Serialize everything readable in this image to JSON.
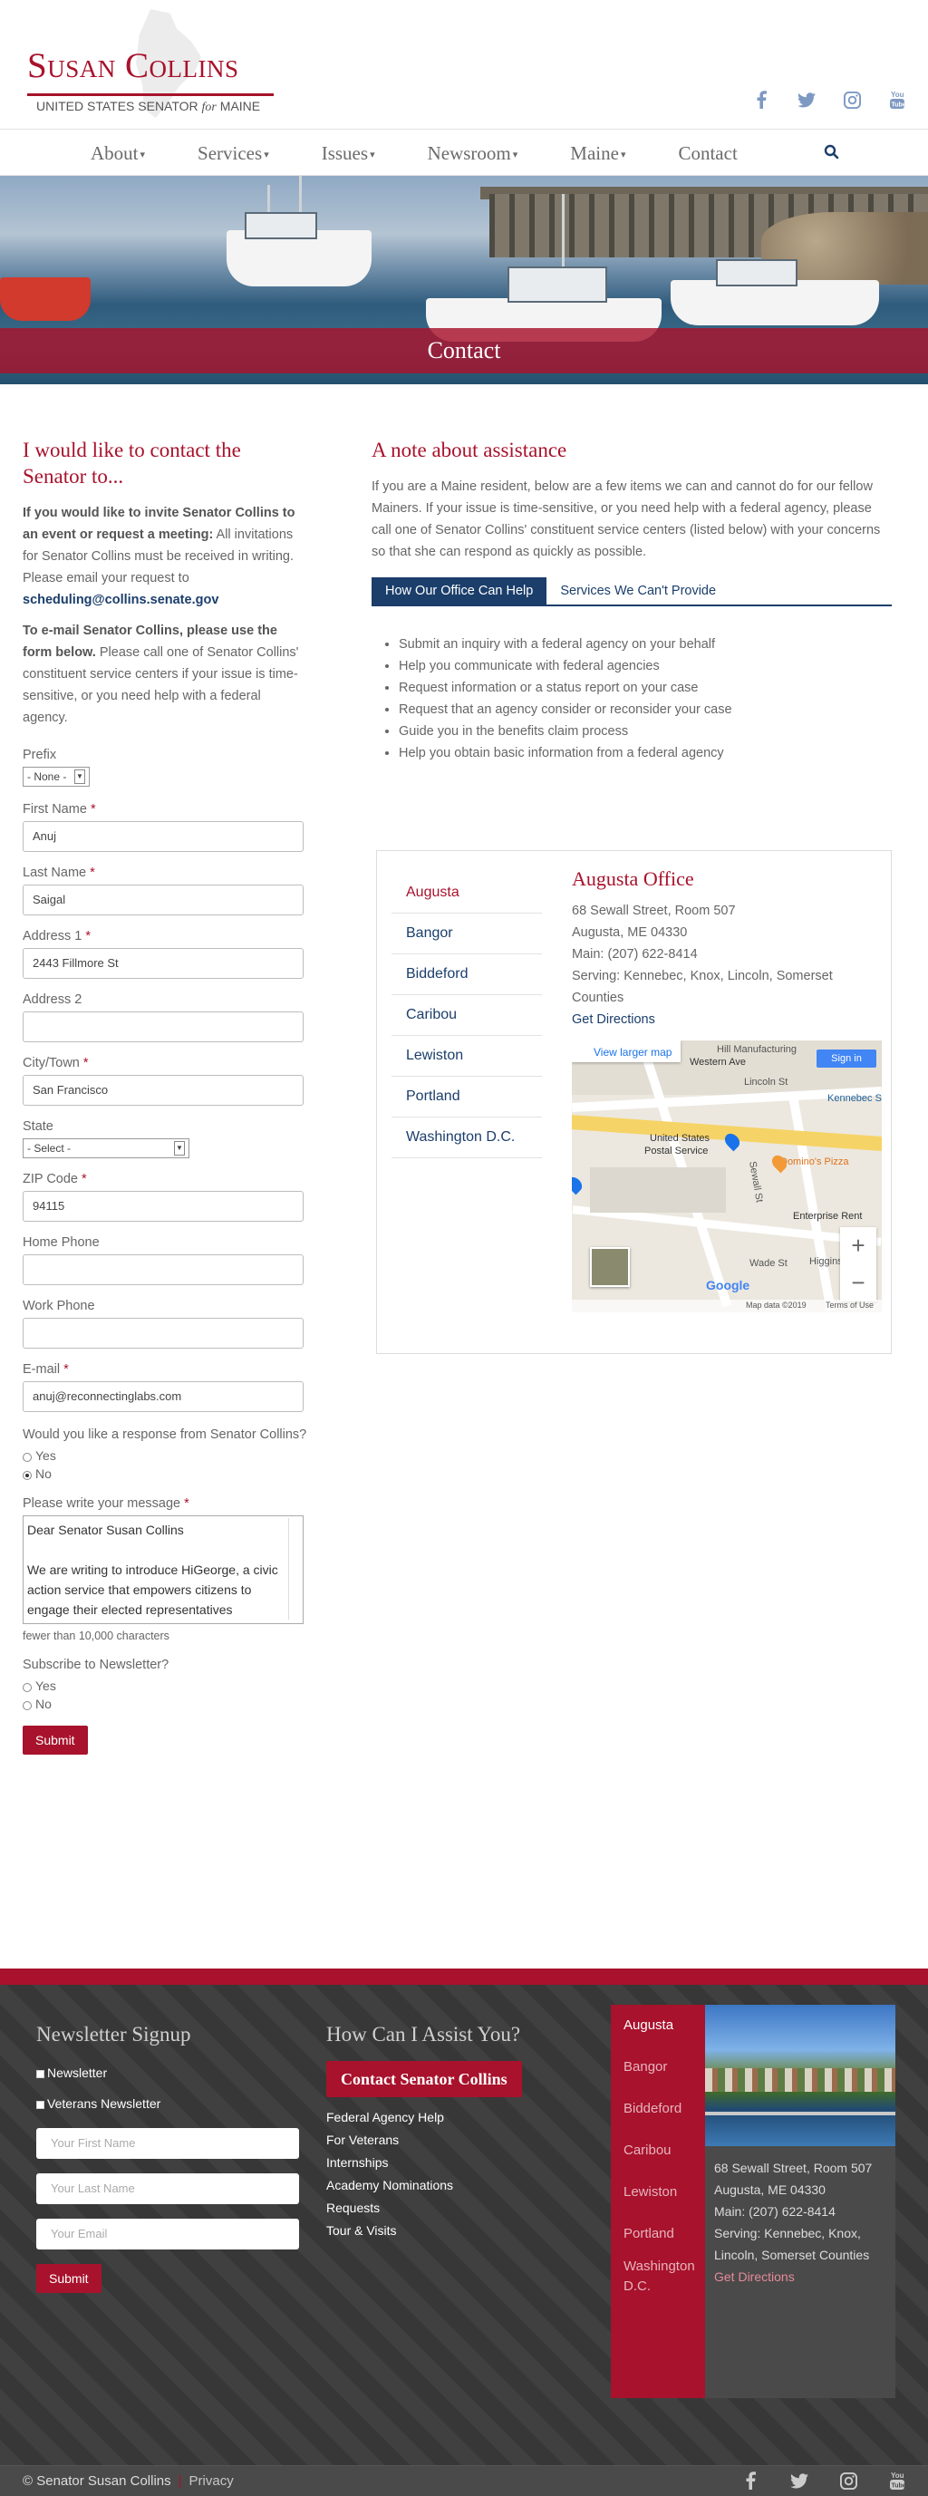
{
  "brand": {
    "name": "Susan Collins",
    "subtitle_pre": "UNITED STATES SENATOR ",
    "subtitle_for": "for",
    "subtitle_post": " MAINE"
  },
  "social": [
    "facebook-icon",
    "twitter-icon",
    "instagram-icon",
    "youtube-icon"
  ],
  "nav": {
    "items": [
      {
        "label": "About",
        "dropdown": true
      },
      {
        "label": "Services",
        "dropdown": true
      },
      {
        "label": "Issues",
        "dropdown": true
      },
      {
        "label": "Newsroom",
        "dropdown": true
      },
      {
        "label": "Maine",
        "dropdown": true
      },
      {
        "label": "Contact",
        "dropdown": false
      }
    ]
  },
  "hero": {
    "title": "Contact"
  },
  "contact": {
    "heading": "I would like to contact the Senator to...",
    "invite_bold": "If you would like to invite Senator Collins to an event or request a meeting:",
    "invite_text": " All invitations for Senator Collins must be received in writing. Please email your request to ",
    "invite_email": "scheduling@collins.senate.gov",
    "email_bold": "To e-mail Senator Collins, please use the form below.",
    "email_text": " Please call one of Senator Collins' constituent service centers if your issue is time-sensitive, or you need help with a federal agency."
  },
  "form": {
    "prefix": {
      "label": "Prefix",
      "value": "- None -"
    },
    "first_name": {
      "label": "First Name",
      "value": "Anuj"
    },
    "last_name": {
      "label": "Last Name",
      "value": "Saigal"
    },
    "address1": {
      "label": "Address 1",
      "value": "2443 Fillmore St"
    },
    "address2": {
      "label": "Address 2",
      "value": ""
    },
    "city": {
      "label": "City/Town",
      "value": "San Francisco"
    },
    "state": {
      "label": "State",
      "value": "- Select -"
    },
    "zip": {
      "label": "ZIP Code",
      "value": "94115"
    },
    "home_phone": {
      "label": "Home Phone",
      "value": ""
    },
    "work_phone": {
      "label": "Work Phone",
      "value": ""
    },
    "email": {
      "label": "E-mail",
      "value": "anuj@reconnectinglabs.com"
    },
    "response": {
      "label": "Would you like a response from Senator Collins?",
      "yes": "Yes",
      "no": "No",
      "selected": "No"
    },
    "message": {
      "label": "Please write your message",
      "line1": "Dear Senator Susan Collins",
      "line2": "We are writing to introduce HiGeorge, a civic action service that empowers citizens to engage their elected representatives",
      "hint": "fewer than 10,000 characters"
    },
    "newsletter": {
      "label": "Subscribe to Newsletter?",
      "yes": "Yes",
      "no": "No"
    },
    "submit": "Submit"
  },
  "assistance": {
    "heading": "A note about assistance",
    "text": "If you are a Maine resident, below are a few items we can and cannot do for our fellow Mainers. If your issue is time-sensitive, or you need help with a federal agency, please call one of Senator Collins' constituent service centers (listed below) with your concerns so that she can respond as quickly as possible.",
    "tabs": [
      "How Our Office Can Help",
      "Services We Can't Provide"
    ],
    "help_items": [
      "Submit an inquiry with a federal agency on your behalf",
      "Help you communicate with federal agencies",
      "Request information or a status report on your case",
      "Request that an agency consider or reconsider your case",
      "Guide you in the benefits claim process",
      "Help you obtain basic information from a federal agency"
    ]
  },
  "offices": {
    "list": [
      "Augusta",
      "Bangor",
      "Biddeford",
      "Caribou",
      "Lewiston",
      "Portland",
      "Washington D.C."
    ],
    "active": "Augusta",
    "detail": {
      "title": "Augusta Office",
      "street": "68 Sewall Street, Room 507",
      "city": "Augusta, ME 04330",
      "phone": "Main: (207) 622-8414",
      "serving": "Serving: Kennebec, Knox, Lincoln, Somerset Counties",
      "directions": "Get Directions"
    },
    "map": {
      "larger": "View larger map",
      "signin": "Sign in",
      "labels": [
        "Western Ave",
        "Lincoln St",
        "Kennebec Saving",
        "United States",
        "Postal Service",
        "Domino's Pizza",
        "Sewall St",
        "Enterprise Rent",
        "Wade St",
        "Higgins",
        "Hill Manufacturing"
      ],
      "footer": "Map data ©2019",
      "terms": "Terms of Use",
      "google": "Google"
    }
  },
  "footer": {
    "newsletter": {
      "heading": "Newsletter Signup",
      "options": [
        "Newsletter",
        "Veterans Newsletter"
      ],
      "first": "Your First Name",
      "last": "Your Last Name",
      "email": "Your Email",
      "submit": "Submit"
    },
    "assist": {
      "heading": "How Can I Assist You?",
      "button": "Contact Senator Collins",
      "links": [
        "Federal Agency Help",
        "For Veterans",
        "Internships",
        "Academy Nominations",
        "Requests",
        "Tour & Visits"
      ]
    },
    "offices": {
      "list": [
        "Augusta",
        "Bangor",
        "Biddeford",
        "Caribou",
        "Lewiston",
        "Portland",
        "Washington D.C."
      ],
      "street": "68 Sewall Street, Room 507",
      "city": "Augusta, ME 04330",
      "phone": "Main: (207) 622-8414",
      "serving": "Serving: Kennebec, Knox, Lincoln, Somerset Counties",
      "directions": "Get Directions"
    },
    "copyright": "© Senator Susan Collins",
    "privacy": "Privacy"
  },
  "colors": {
    "brand_red": "#a8122c",
    "navy": "#1b3e6b",
    "social_blue": "#7d99c2"
  }
}
